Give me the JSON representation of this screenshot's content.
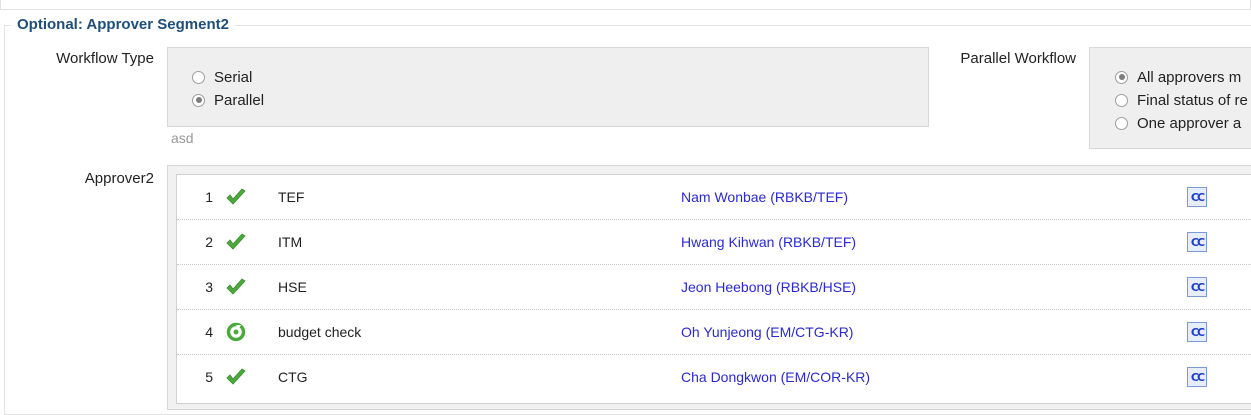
{
  "section": {
    "title": "Optional: Approver Segment2"
  },
  "workflow_type": {
    "label": "Workflow Type",
    "options": [
      {
        "label": "Serial",
        "checked": false
      },
      {
        "label": "Parallel",
        "checked": true
      }
    ],
    "hint": "asd"
  },
  "parallel_workflow": {
    "label": "Parallel Workflow",
    "options": [
      {
        "label": "All approvers m",
        "checked": true
      },
      {
        "label": "Final status of re",
        "checked": false
      },
      {
        "label": "One approver a",
        "checked": false
      }
    ]
  },
  "approvers": {
    "label": "Approver2",
    "rows": [
      {
        "num": "1",
        "status_icon": "check-icon",
        "step": "TEF",
        "person": "Nam Wonbae (RBKB/TEF)",
        "cc_label": "CC"
      },
      {
        "num": "2",
        "status_icon": "check-icon",
        "step": "ITM",
        "person": "Hwang Kihwan (RBKB/TEF)",
        "cc_label": "CC"
      },
      {
        "num": "3",
        "status_icon": "check-icon",
        "step": "HSE",
        "person": "Jeon Heebong (RBKB/HSE)",
        "cc_label": "CC"
      },
      {
        "num": "4",
        "status_icon": "in-progress-icon",
        "step": "budget check",
        "person": "Oh Yunjeong (EM/CTG-KR)",
        "cc_label": "CC"
      },
      {
        "num": "5",
        "status_icon": "check-icon",
        "step": "CTG",
        "person": "Cha Dongkwon (EM/COR-KR)",
        "cc_label": "CC"
      }
    ]
  },
  "colors": {
    "legend": "#1f4e79",
    "link": "#2a2ad0",
    "check": "#4caa3c"
  }
}
